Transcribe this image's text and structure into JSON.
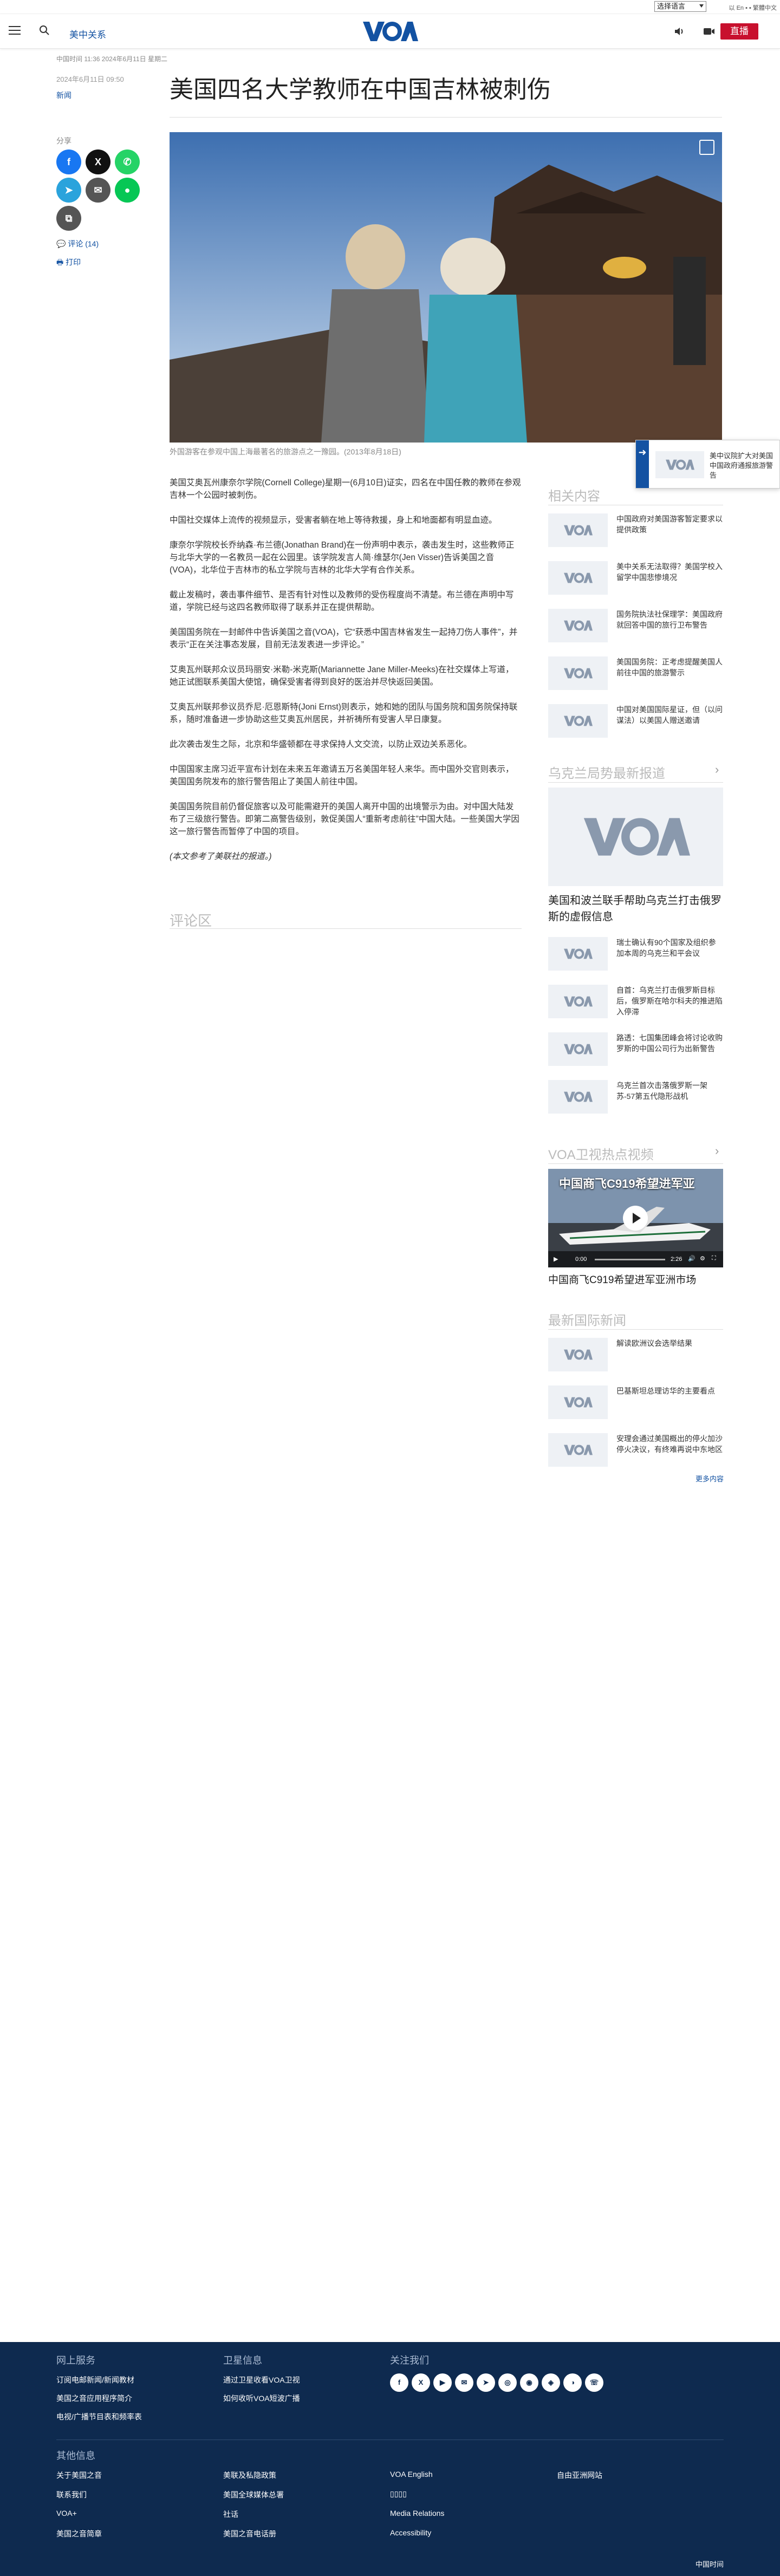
{
  "top_strip": {
    "language_select": "选择语言",
    "language_links": "以 En ▪ ▪ 繁體中文"
  },
  "header": {
    "section": "美中关系",
    "logo": "VOA",
    "live_label": "直播"
  },
  "article": {
    "meta": "中国时间 11:36 2024年6月11日 星期二",
    "date": "2024年6月11日 09:50",
    "topic": "新闻",
    "title": "美国四名大学教师在中国吉林被刺伤",
    "caption": "外国游客在参观中国上海最著名的旅游点之一豫园。(2013年8月18日)",
    "paragraphs": [
      "美国艾奥瓦州康奈尔学院(Cornell College)星期一(6月10日)证实，四名在中国任教的教师在参观吉林一个公园时被刺伤。",
      "中国社交媒体上流传的视频显示，受害者躺在地上等待救援，身上和地面都有明显血迹。",
      "康奈尔学院校长乔纳森·布兰德(Jonathan Brand)在一份声明中表示，袭击发生时，这些教师正与北华大学的一名教员一起在公园里。该学院发言人简·维瑟尔(Jen Visser)告诉美国之音(VOA)，北华位于吉林市的私立学院与吉林的北华大学有合作关系。",
      "截止发稿时，袭击事件细节、是否有针对性以及教师的受伤程度尚不清楚。布兰德在声明中写道，学院已经与这四名教师取得了联系并正在提供帮助。",
      "美国国务院在一封邮件中告诉美国之音(VOA)，它“获悉中国吉林省发生一起持刀伤人事件”，并表示“正在关注事态发展，目前无法发表进一步评论。”",
      "艾奥瓦州联邦众议员玛丽安·米勒-米克斯(Mariannette Jane Miller-Meeks)在社交媒体上写道，她正试图联系美国大使馆，确保受害者得到良好的医治并尽快返回美国。",
      "艾奥瓦州联邦参议员乔尼·厄恩斯特(Joni Ernst)则表示，她和她的团队与国务院和国务院保持联系，随时准备进一步协助这些艾奥瓦州居民，并祈祷所有受害人早日康复。",
      "此次袭击发生之际，北京和华盛顿都在寻求保持人文交流，以防止双边关系恶化。",
      "中国国家主席习近平宣布计划在未来五年邀请五万名美国年轻人来华。而中国外交官则表示，美国国务院发布的旅行警告阻止了美国人前往中国。",
      "美国国务院目前仍督促旅客以及可能需避开的美国人离开中国的出境警示为由。对中国大陆发布了三级旅行警告。即第二高警告级别，敦促美国人“重新考虑前往”中国大陆。一些美国大学因这一旅行警告而暂停了中国的项目。",
      "(本文参考了美联社的报道。)"
    ],
    "comments_heading": "评论区"
  },
  "share": {
    "label": "分享",
    "comments_link": "评论 (14)",
    "print_link": "打印"
  },
  "popup": {
    "text": "美中议院扩大对美国中国政府通报旅游警告"
  },
  "sidebar": {
    "related_heading": "相关内容",
    "related": [
      "中国政府对美国游客暂定要求以提供政策",
      "美中关系无法取得？美国学校入留学中国悲惨境况",
      "国务院执法社保理学：美国政府就回答中国的旅行卫布警告",
      "美国国务院：正考虑提醒美国人前往中国的旅游警示",
      "中国对美国国际星证，但（以问谋法）以美国人赠送邀请"
    ],
    "ukraine_heading": "乌克兰局势最新报道",
    "ukraine_feature": "美国和波兰联手帮助乌克兰打击俄罗斯的虚假信息",
    "ukraine_items": [
      "瑞士确认有90个国家及组织参加本周的乌克兰和平会议",
      "自首：乌克兰打击俄罗斯目标后，俄罗斯在哈尔科夫的推进陷入停滞",
      "路透：七国集团峰会将讨论收购罗斯的中国公司行为出新警告",
      "乌克兰首次击落俄罗斯一架苏-57第五代隐形战机"
    ],
    "video_heading": "VOA卫视热点视频",
    "video_overlay": "中国商飞C919希望进军亚",
    "video_time": "0:00",
    "video_duration": "2:26",
    "video_caption": "中国商飞C919希望进军亚洲市场",
    "news_heading": "最新国际新闻",
    "news_items": [
      "解读欧洲议会选举结果",
      "巴基斯坦总理访华的主要看点",
      "安理会通过美国概出的停火加沙停火决议，有终难再说中东地区"
    ],
    "more_label": "更多内容"
  },
  "footer": {
    "online_heading": "网上服务",
    "online_links": [
      "订阅电邮新闻/新闻教材",
      "美国之音应用程序简介",
      "电视/广播节目表和频率表"
    ],
    "satellite_heading": "卫星信息",
    "satellite_links": [
      "通过卫星收看VOA卫视",
      "如何收听VOA短波广播"
    ],
    "follow_heading": "关注我们",
    "social": [
      "f",
      "X",
      "▶",
      "✉",
      "➤",
      "◎",
      "◉",
      "◈",
      "◑",
      "☏"
    ],
    "other_heading": "其他信息",
    "other_col1": [
      "关于美国之音",
      "联系我们",
      "VOA+",
      "美国之音简章"
    ],
    "other_col2": [
      "美联及私隐政策",
      "美国全球媒体总署",
      "社话",
      "美国之音电话册"
    ],
    "other_col3": [
      "VOA English",
      "▯▯▯▯",
      "Media Relations",
      "Accessibility"
    ],
    "other_col4": [
      "自由亚洲网站"
    ],
    "copyright": "中国时间"
  },
  "colors": {
    "brand_blue": "#1352a2",
    "live_red": "#c8102e",
    "footer_navy": "#0e2a4f"
  }
}
